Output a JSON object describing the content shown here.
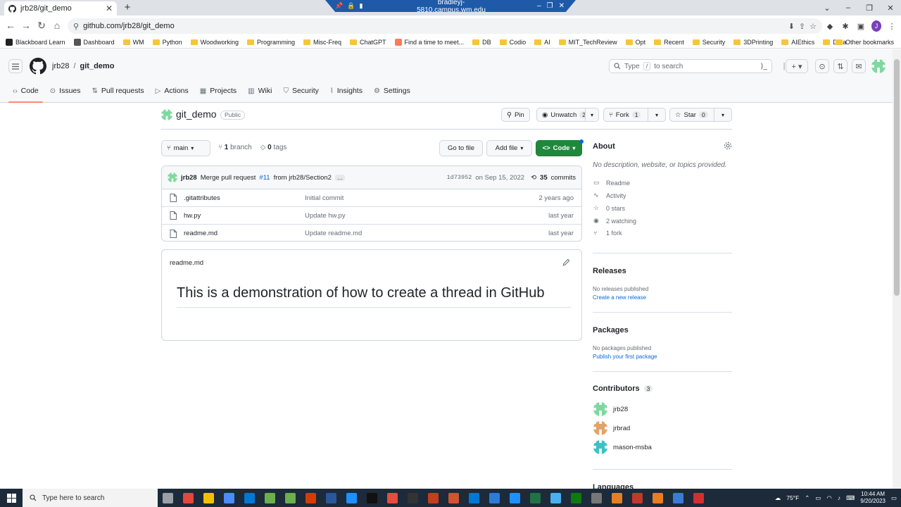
{
  "browser": {
    "tab_title": "jrb28/git_demo",
    "rdp_host": "bradleyj-5810.campus.wm.edu",
    "url": "github.com/jrb28/git_demo",
    "profile_initial": "J"
  },
  "bookmarks": [
    {
      "label": "Blackboard Learn",
      "icon": "blackboard-icon"
    },
    {
      "label": "Dashboard",
      "icon": "dashboard-icon"
    },
    {
      "label": "WM",
      "icon": "folder-icon"
    },
    {
      "label": "Python",
      "icon": "folder-icon"
    },
    {
      "label": "Woodworking",
      "icon": "folder-icon"
    },
    {
      "label": "Programming",
      "icon": "folder-icon"
    },
    {
      "label": "Misc-Freq",
      "icon": "folder-icon"
    },
    {
      "label": "ChatGPT",
      "icon": "folder-icon"
    },
    {
      "label": "Find a time to meet...",
      "icon": "hubspot-icon"
    },
    {
      "label": "DB",
      "icon": "folder-icon"
    },
    {
      "label": "Codio",
      "icon": "folder-icon"
    },
    {
      "label": "AI",
      "icon": "folder-icon"
    },
    {
      "label": "MIT_TechReview",
      "icon": "folder-icon"
    },
    {
      "label": "Opt",
      "icon": "folder-icon"
    },
    {
      "label": "Recent",
      "icon": "folder-icon"
    },
    {
      "label": "Security",
      "icon": "folder-icon"
    },
    {
      "label": "3DPrinting",
      "icon": "folder-icon"
    },
    {
      "label": "AIEthics",
      "icon": "folder-icon"
    },
    {
      "label": "Data",
      "icon": "folder-icon"
    }
  ],
  "other_bookmarks": "Other bookmarks",
  "github": {
    "owner": "jrb28",
    "separator": "/",
    "repo": "git_demo",
    "search_prefix": "Type",
    "search_key": "/",
    "search_suffix": "to search",
    "nav": [
      {
        "label": "Code",
        "icon": "code-icon",
        "selected": true
      },
      {
        "label": "Issues",
        "icon": "issue-icon"
      },
      {
        "label": "Pull requests",
        "icon": "pull-request-icon"
      },
      {
        "label": "Actions",
        "icon": "actions-icon"
      },
      {
        "label": "Projects",
        "icon": "projects-icon"
      },
      {
        "label": "Wiki",
        "icon": "wiki-icon"
      },
      {
        "label": "Security",
        "icon": "shield-icon"
      },
      {
        "label": "Insights",
        "icon": "graph-icon"
      },
      {
        "label": "Settings",
        "icon": "gear-icon"
      }
    ]
  },
  "repo": {
    "name": "git_demo",
    "visibility": "Public",
    "pin": "Pin",
    "unwatch": "Unwatch",
    "watch_count": "2",
    "fork": "Fork",
    "fork_count": "1",
    "star": "Star",
    "star_count": "0",
    "branch": "main",
    "branch_count": "1",
    "branch_label": "branch",
    "tag_count": "0",
    "tag_label": "tags",
    "go_to_file": "Go to file",
    "add_file": "Add file",
    "code": "Code"
  },
  "commit": {
    "author": "jrb28",
    "message_prefix": "Merge pull request",
    "pr": "#11",
    "message_suffix": "from jrb28/Section2",
    "ellipsis": "…",
    "sha": "1d73952",
    "date": "on Sep 15, 2022",
    "count": "35",
    "count_label": "commits"
  },
  "files": [
    {
      "name": ".gitattributes",
      "message": "Initial commit",
      "age": "2 years ago"
    },
    {
      "name": "hw.py",
      "message": "Update hw.py",
      "age": "last year"
    },
    {
      "name": "readme.md",
      "message": "Update readme.md",
      "age": "last year"
    }
  ],
  "readme": {
    "filename": "readme.md",
    "heading": "This is a demonstration of how to create a thread in GitHub"
  },
  "about": {
    "title": "About",
    "description": "No description, website, or topics provided.",
    "items": [
      {
        "label": "Readme",
        "icon": "book-icon"
      },
      {
        "label": "Activity",
        "icon": "pulse-icon"
      },
      {
        "label": "0 stars",
        "icon": "star-icon"
      },
      {
        "label": "2 watching",
        "icon": "eye-icon"
      },
      {
        "label": "1 fork",
        "icon": "fork-icon"
      }
    ]
  },
  "releases": {
    "title": "Releases",
    "empty": "No releases published",
    "link": "Create a new release"
  },
  "packages": {
    "title": "Packages",
    "empty": "No packages published",
    "link": "Publish your first package"
  },
  "contributors": {
    "title": "Contributors",
    "count": "3",
    "people": [
      {
        "name": "jrb28",
        "color": "#7ed8a0"
      },
      {
        "name": "jrbrad",
        "color": "#e0a46a"
      },
      {
        "name": "mason-msba",
        "color": "#38c4c4"
      }
    ]
  },
  "languages_title": "Languages",
  "taskbar": {
    "search_placeholder": "Type here to search",
    "weather": "75°F",
    "time": "10:44 AM",
    "date": "9/20/2023"
  },
  "colors": {
    "accent_green": "#1f883d",
    "link_blue": "#0969da",
    "tab_underline": "#fd8c73"
  }
}
